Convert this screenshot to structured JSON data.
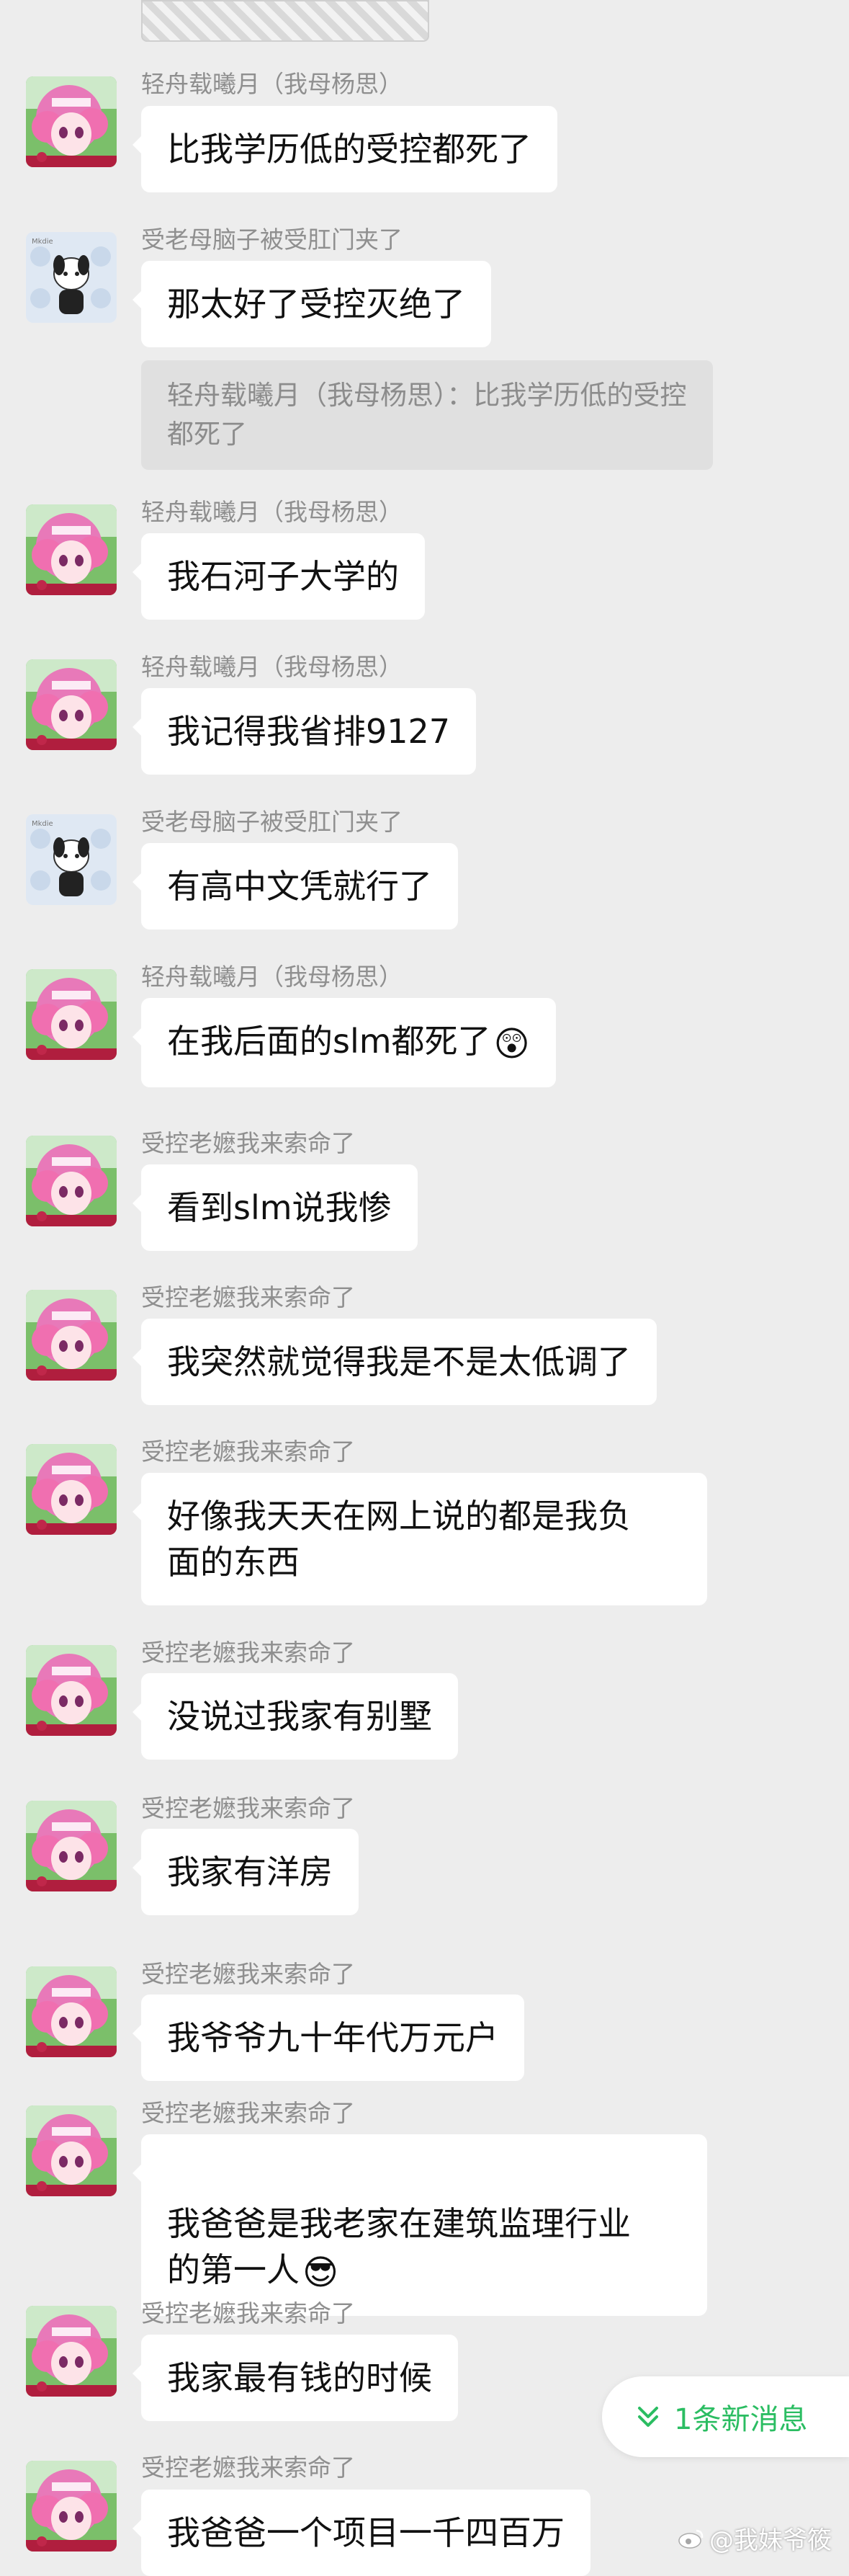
{
  "colors": {
    "background": "#ededed",
    "bubble": "#ffffff",
    "quote_bg": "#e0e0e0",
    "accent_green": "#2bbd62"
  },
  "messages": [
    {
      "sender": "轻舟载曦月（我母杨思）",
      "text": "比我学历低的受控都死了",
      "avatar": "pink-anime-avatar"
    },
    {
      "sender": "受老母脑子被受肛门夹了",
      "text": "那太好了受控灭绝了",
      "avatar": "cartoon-dog-avatar",
      "quote": "轻舟载曦月（我母杨思）：比我学历低的受控都死了"
    },
    {
      "sender": "轻舟载曦月（我母杨思）",
      "text": "我石河子大学的",
      "avatar": "pink-anime-avatar"
    },
    {
      "sender": "轻舟载曦月（我母杨思）",
      "text": "我记得我省排9127",
      "avatar": "pink-anime-avatar"
    },
    {
      "sender": "受老母脑子被受肛门夹了",
      "text": "有高中文凭就行了",
      "avatar": "cartoon-dog-avatar"
    },
    {
      "sender": "轻舟载曦月（我母杨思）",
      "text": "在我后面的slm都死了",
      "emoji": "😲",
      "avatar": "pink-anime-avatar"
    },
    {
      "sender": "受控老嬷我来索命了",
      "text": "看到slm说我惨",
      "avatar": "pink-anime-avatar"
    },
    {
      "sender": "受控老嬷我来索命了",
      "text": "我突然就觉得我是不是太低调了",
      "avatar": "pink-anime-avatar"
    },
    {
      "sender": "受控老嬷我来索命了",
      "text": "好像我天天在网上说的都是我负\n面的东西",
      "avatar": "pink-anime-avatar"
    },
    {
      "sender": "受控老嬷我来索命了",
      "text": "没说过我家有别墅",
      "avatar": "pink-anime-avatar"
    },
    {
      "sender": "受控老嬷我来索命了",
      "text": "我家有洋房",
      "avatar": "pink-anime-avatar"
    },
    {
      "sender": "受控老嬷我来索命了",
      "text": "我爷爷九十年代万元户",
      "avatar": "pink-anime-avatar"
    },
    {
      "sender": "受控老嬷我来索命了",
      "text": "我爸爸是我老家在建筑监理行业\n的第一人",
      "emoji": "😎",
      "avatar": "pink-anime-avatar"
    },
    {
      "sender": "受控老嬷我来索命了",
      "text": "我家最有钱的时候",
      "avatar": "pink-anime-avatar"
    },
    {
      "sender": "受控老嬷我来索命了",
      "text": "我爸爸一个项目一千四百万",
      "avatar": "pink-anime-avatar"
    }
  ],
  "new_message_pill": {
    "label": "1条新消息",
    "icon": "double-chevron-down-icon"
  },
  "watermark": {
    "text": "@我妹爷筱",
    "icon": "weibo-icon"
  }
}
